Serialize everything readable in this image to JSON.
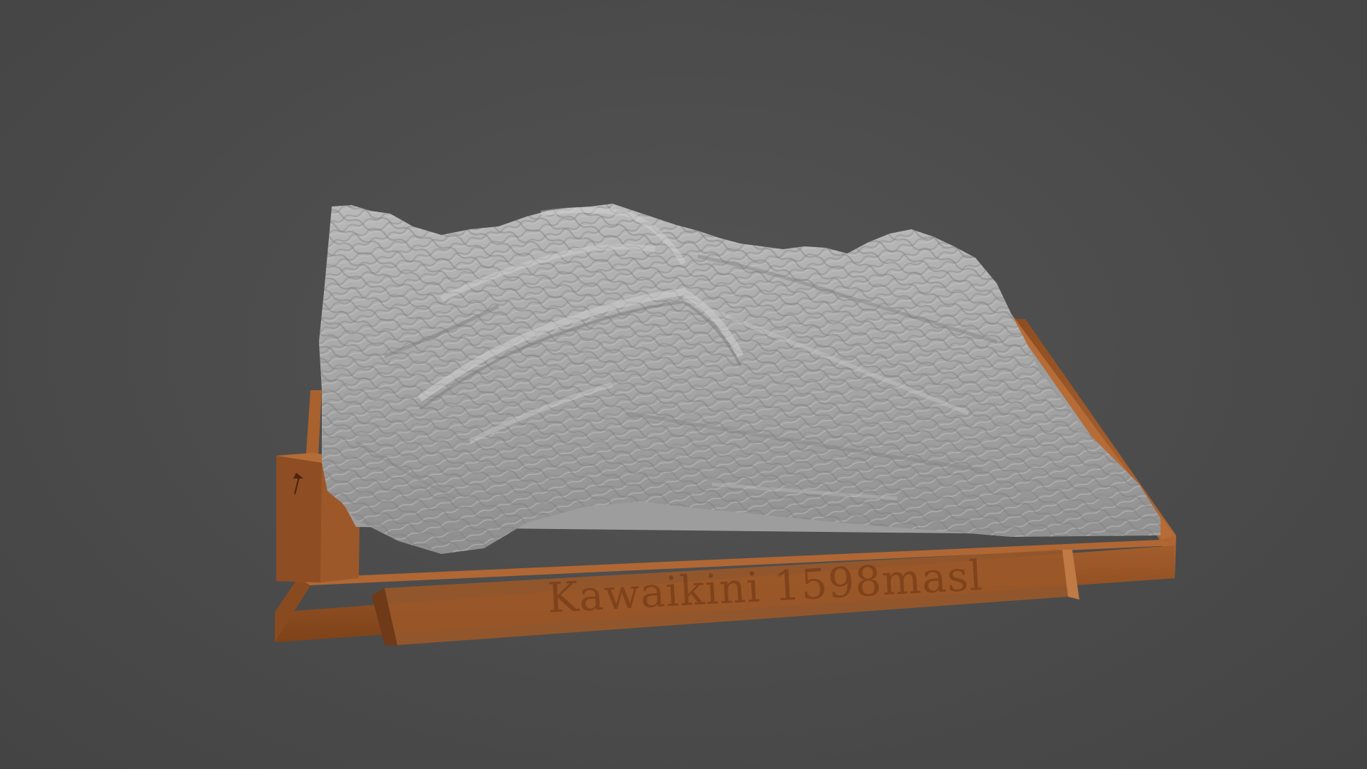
{
  "scene": {
    "background_color": "#4a4a4a",
    "terrain_color": "#a9a9a9",
    "base_color": "#9c5a2c",
    "base_shadow_color": "#6e3a18"
  },
  "model": {
    "label": "Kawaikini 1598masl",
    "legend_icons": [
      "scale-icon",
      "north-arrow-icon"
    ]
  }
}
